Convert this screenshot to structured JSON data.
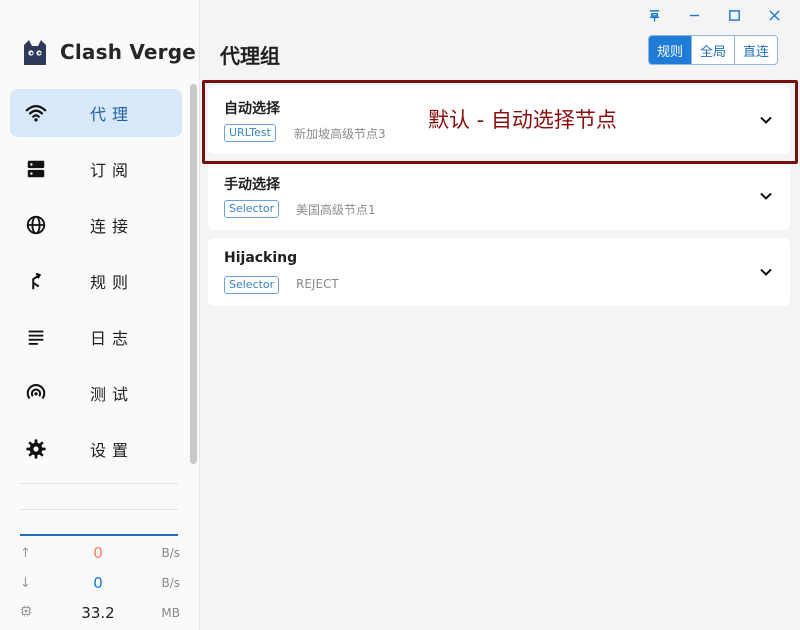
{
  "app": {
    "name": "Clash Verge"
  },
  "sidebar": {
    "items": [
      {
        "label": "代理",
        "icon": "wifi-icon",
        "active": true
      },
      {
        "label": "订阅",
        "icon": "server-icon",
        "active": false
      },
      {
        "label": "连接",
        "icon": "globe-icon",
        "active": false
      },
      {
        "label": "规则",
        "icon": "fork-icon",
        "active": false
      },
      {
        "label": "日志",
        "icon": "lines-icon",
        "active": false
      },
      {
        "label": "测试",
        "icon": "signal-icon",
        "active": false
      },
      {
        "label": "设置",
        "icon": "gear-icon",
        "active": false
      }
    ]
  },
  "traffic": {
    "upload": {
      "value": "0",
      "unit": "B/s",
      "color": "#f08060"
    },
    "download": {
      "value": "0",
      "unit": "B/s",
      "color": "#1976d2"
    },
    "memory": {
      "value": "33.2",
      "unit": "MB"
    }
  },
  "header": {
    "title": "代理组",
    "modes": [
      {
        "label": "规则",
        "active": true
      },
      {
        "label": "全局",
        "active": false
      },
      {
        "label": "直连",
        "active": false
      }
    ]
  },
  "groups": [
    {
      "name": "自动选择",
      "type": "URLTest",
      "now": "新加坡高级节点3"
    },
    {
      "name": "手动选择",
      "type": "Selector",
      "now": "美国高级节点1"
    },
    {
      "name": "Hijacking",
      "type": "Selector",
      "now": "REJECT"
    }
  ],
  "annotation": {
    "text": "默认 - 自动选择节点",
    "color": "#8b0e0e"
  },
  "colors": {
    "accent": "#1e7bd8",
    "active_nav_bg": "#d7e8fb"
  }
}
